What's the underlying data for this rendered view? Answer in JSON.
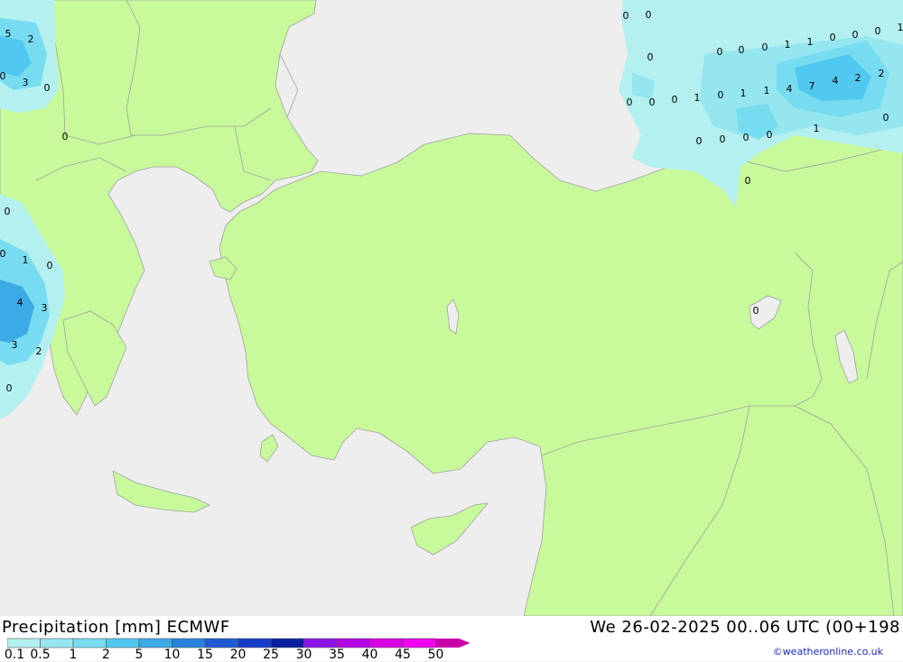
{
  "title": "Precipitation [mm] ECMWF",
  "datetime": "We 26-02-2025 00..06 UTC (00+198",
  "credit": "©weatheronline.co.uk",
  "legend": {
    "ticks": [
      "0.1",
      "0.5",
      "1",
      "2",
      "5",
      "10",
      "15",
      "20",
      "25",
      "30",
      "35",
      "40",
      "45",
      "50"
    ],
    "colors": [
      "#b4f0f0",
      "#96e6f0",
      "#78dcf0",
      "#50c8f0",
      "#3caae6",
      "#2882dc",
      "#1e5ad2",
      "#143cc8",
      "#0a1ea0",
      "#8c14e6",
      "#b400e6",
      "#dc00e6",
      "#f000f0",
      "#c800aa"
    ]
  },
  "colors": {
    "land": "#c8fa9b",
    "sea": "#eeeeee",
    "border": "#a0a0a0"
  },
  "precip_labels": [
    {
      "v": "5"
    },
    {
      "v": "2"
    },
    {
      "v": "0"
    },
    {
      "v": "3"
    },
    {
      "v": "0"
    },
    {
      "v": "0"
    },
    {
      "v": "0"
    },
    {
      "v": "0"
    },
    {
      "v": "1"
    },
    {
      "v": "0"
    },
    {
      "v": "4"
    },
    {
      "v": "3"
    },
    {
      "v": "3"
    },
    {
      "v": "2"
    },
    {
      "v": "0"
    },
    {
      "v": "0"
    },
    {
      "v": "0"
    },
    {
      "v": "0"
    },
    {
      "v": "0"
    },
    {
      "v": "0"
    },
    {
      "v": "0"
    },
    {
      "v": "0"
    },
    {
      "v": "0"
    },
    {
      "v": "0"
    },
    {
      "v": "1"
    },
    {
      "v": "1"
    },
    {
      "v": "0"
    },
    {
      "v": "0"
    },
    {
      "v": "0"
    },
    {
      "v": "1"
    },
    {
      "v": "1"
    },
    {
      "v": "0"
    },
    {
      "v": "1"
    },
    {
      "v": "1"
    },
    {
      "v": "4"
    },
    {
      "v": "7"
    },
    {
      "v": "4"
    },
    {
      "v": "2"
    },
    {
      "v": "2"
    },
    {
      "v": "0"
    },
    {
      "v": "1"
    },
    {
      "v": "0"
    },
    {
      "v": "0"
    },
    {
      "v": "0"
    },
    {
      "v": "0"
    },
    {
      "v": "0"
    },
    {
      "v": "0"
    }
  ]
}
